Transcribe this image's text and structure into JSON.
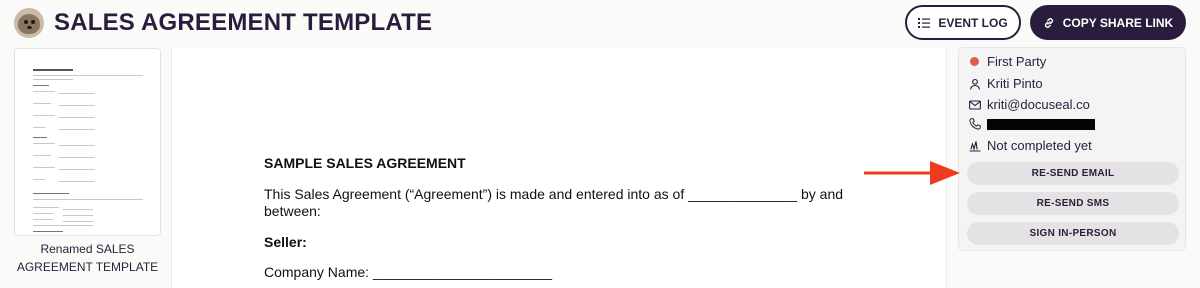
{
  "header": {
    "title": "SALES AGREEMENT TEMPLATE",
    "event_log_label": "EVENT LOG",
    "copy_share_label": "COPY SHARE LINK"
  },
  "sidebar": {
    "thumbnail_caption": "Renamed SALES AGREEMENT TEMPLATE"
  },
  "document": {
    "heading": "SAMPLE SALES AGREEMENT",
    "intro": "This Sales Agreement (“Agreement”) is made and entered into as of ______________ by and between:",
    "seller_label": "Seller:",
    "company_name": "Company Name: _______________________"
  },
  "submitter": {
    "party": "First Party",
    "party_color": "#e05a4e",
    "name": "Kriti Pinto",
    "email": "kriti@docuseal.co",
    "status": "Not completed yet",
    "resend_email_label": "RE-SEND EMAIL",
    "resend_sms_label": "RE-SEND SMS",
    "sign_in_person_label": "SIGN IN-PERSON"
  },
  "annotation": {
    "arrow_color": "#f03a1e"
  }
}
